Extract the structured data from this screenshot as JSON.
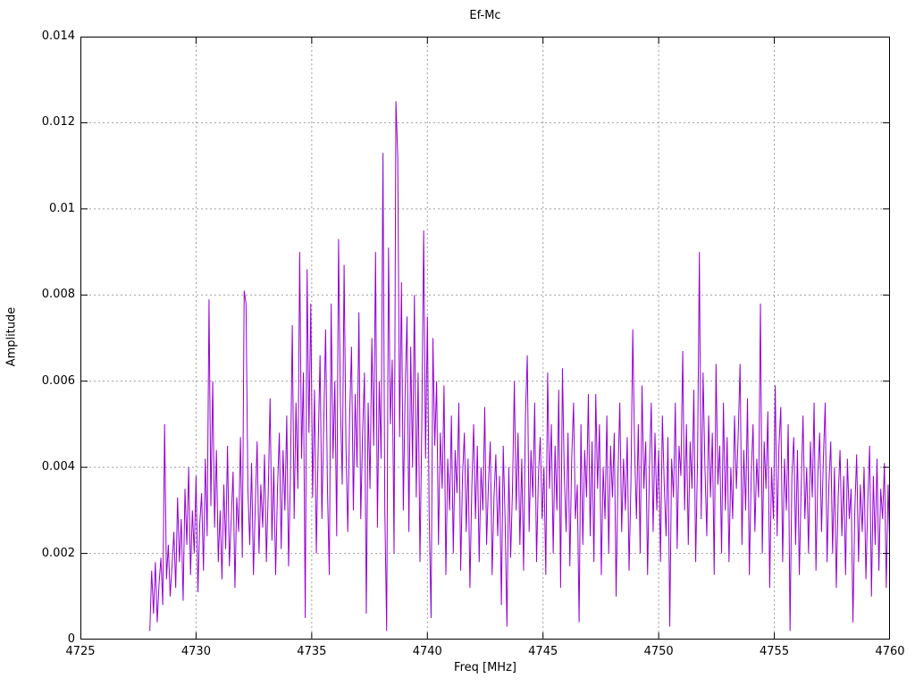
{
  "chart_data": {
    "type": "line",
    "title": "Ef-Mc",
    "xlabel": "Freq [MHz]",
    "ylabel": "Amplitude",
    "xlim": [
      4725,
      4760
    ],
    "ylim": [
      0,
      0.014
    ],
    "grid": true,
    "legend": "none",
    "xticks": {
      "values": [
        4725,
        4730,
        4735,
        4740,
        4745,
        4750,
        4755,
        4760
      ],
      "labels": [
        "4725",
        "4730",
        "4735",
        "4740",
        "4745",
        "4750",
        "4755",
        "4760"
      ]
    },
    "yticks": {
      "values": [
        0,
        0.002,
        0.004,
        0.006,
        0.008,
        0.01,
        0.012,
        0.014
      ],
      "labels": [
        "0",
        "0.002",
        "0.004",
        "0.006",
        "0.008",
        "0.01",
        "0.012",
        "0.014"
      ]
    },
    "colors": {
      "line": "#9400d3",
      "grid": "#9e9e9e",
      "border": "#000000",
      "text": "#000000",
      "background": "#ffffff"
    },
    "series": [
      {
        "name": "Ef-Mc",
        "x_start": 4728.0,
        "x_step": 0.08,
        "amp_scale": 0.0001,
        "amps": [
          2,
          16,
          6,
          18,
          4,
          13,
          19,
          8,
          50,
          14,
          22,
          10,
          17,
          25,
          12,
          33,
          18,
          28,
          9,
          35,
          22,
          40,
          15,
          30,
          20,
          38,
          11,
          27,
          34,
          16,
          42,
          24,
          79,
          31,
          60,
          26,
          44,
          18,
          30,
          14,
          36,
          21,
          45,
          17,
          28,
          39,
          12,
          33,
          25,
          47,
          19,
          81,
          78,
          35,
          22,
          41,
          15,
          31,
          46,
          20,
          36,
          26,
          43,
          18,
          34,
          56,
          23,
          40,
          15,
          35,
          48,
          21,
          44,
          30,
          52,
          17,
          38,
          73,
          28,
          55,
          35,
          90,
          42,
          62,
          5,
          86,
          48,
          78,
          33,
          58,
          20,
          45,
          66,
          28,
          50,
          72,
          35,
          15,
          78,
          42,
          60,
          24,
          93,
          55,
          36,
          87,
          45,
          25,
          52,
          68,
          30,
          57,
          40,
          76,
          28,
          48,
          62,
          6,
          55,
          35,
          70,
          45,
          90,
          26,
          60,
          42,
          113,
          30,
          2,
          91,
          50,
          65,
          20,
          125,
          112,
          47,
          83,
          30,
          58,
          75,
          25,
          68,
          40,
          80,
          33,
          62,
          18,
          50,
          95,
          42,
          75,
          28,
          5,
          70,
          45,
          60,
          22,
          48,
          35,
          59,
          15,
          42,
          30,
          52,
          20,
          44,
          34,
          55,
          16,
          38,
          48,
          25,
          42,
          12,
          35,
          50,
          28,
          45,
          18,
          40,
          30,
          54,
          22,
          36,
          46,
          15,
          33,
          43,
          24,
          38,
          8,
          45,
          28,
          3,
          40,
          19,
          35,
          60,
          30,
          48,
          22,
          42,
          16,
          52,
          66,
          25,
          44,
          33,
          55,
          18,
          38,
          47,
          28,
          40,
          15,
          62,
          35,
          50,
          20,
          45,
          30,
          58,
          12,
          63,
          38,
          25,
          48,
          17,
          42,
          55,
          28,
          36,
          4,
          50,
          22,
          44,
          33,
          57,
          24,
          46,
          18,
          57,
          35,
          50,
          15,
          40,
          28,
          52,
          20,
          45,
          33,
          48,
          10,
          38,
          55,
          25,
          42,
          30,
          47,
          16,
          36,
          72,
          44,
          28,
          50,
          20,
          59,
          35,
          46,
          15,
          40,
          55,
          25,
          48,
          30,
          44,
          18,
          52,
          36,
          24,
          47,
          3,
          42,
          33,
          55,
          21,
          45,
          38,
          67,
          30,
          50,
          22,
          46,
          35,
          58,
          18,
          42,
          90,
          28,
          62,
          40,
          24,
          52,
          33,
          48,
          15,
          64,
          36,
          45,
          20,
          55,
          30,
          47,
          18,
          40,
          28,
          52,
          35,
          48,
          64,
          22,
          44,
          30,
          56,
          15,
          38,
          50,
          25,
          42,
          33,
          78,
          20,
          46,
          35,
          53,
          12,
          40,
          28,
          59,
          24,
          45,
          54,
          18,
          42,
          30,
          50,
          2,
          38,
          47,
          22,
          44,
          15,
          35,
          52,
          28,
          40,
          20,
          46,
          33,
          55,
          16,
          38,
          48,
          25,
          42,
          55,
          18,
          36,
          46,
          20,
          40,
          12,
          33,
          44,
          24,
          38,
          15,
          42,
          28,
          35,
          4,
          30,
          43,
          18,
          36,
          25,
          40,
          14,
          32,
          45,
          10,
          38,
          22,
          42,
          16,
          35,
          28,
          41,
          12,
          36,
          20
        ]
      }
    ]
  },
  "layout_note": "gnuplot-style spectrum plot, dashed gray grid, inward mirrored ticks"
}
